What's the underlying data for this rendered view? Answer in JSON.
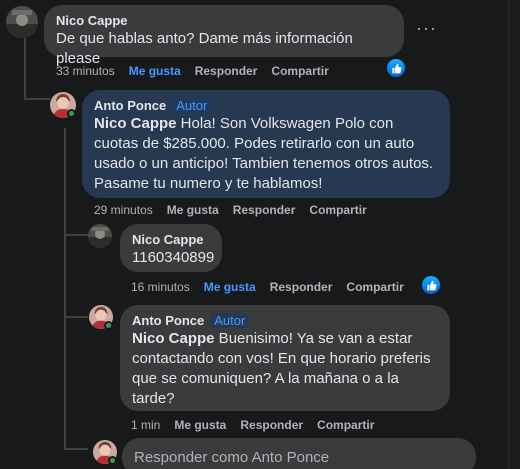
{
  "comments": [
    {
      "author": "Nico Cappe",
      "text": "De que hablas anto? Dame más información please",
      "time": "33 minutos",
      "like": "Me gusta",
      "reply": "Responder",
      "share": "Compartir",
      "liked": true
    },
    {
      "author": "Anto Ponce",
      "badge": "Autor",
      "mention": "Nico Cappe",
      "text": " Hola! Son Volkswagen Polo con cuotas de $285.000. Podes retirarlo con un auto usado o un anticipo! Tambien tenemos otros autos. Pasame tu numero y te hablamos!",
      "time": "29 minutos",
      "like": "Me gusta",
      "reply": "Responder",
      "share": "Compartir"
    },
    {
      "author": "Nico Cappe",
      "text": "1160340899",
      "time": "16 minutos",
      "like": "Me gusta",
      "reply": "Responder",
      "share": "Compartir",
      "liked": true
    },
    {
      "author": "Anto Ponce",
      "badge": "Autor",
      "mention": "Nico Cappe",
      "text": " Buenisimo! Ya se van a estar contactando con vos! En que horario preferis que se comuniquen? A la mañana o a la tarde?",
      "time": "1 min",
      "like": "Me gusta",
      "reply": "Responder",
      "share": "Compartir"
    }
  ],
  "reply_box": {
    "placeholder": "Responder como Anto Ponce"
  },
  "icons": {
    "more": "more-options-icon",
    "reaction": "thumbs-up-icon"
  },
  "colors": {
    "background": "#18191a",
    "bubble": "#3a3b3c",
    "highlight_bubble": "#263951",
    "accent": "#4599ff"
  }
}
